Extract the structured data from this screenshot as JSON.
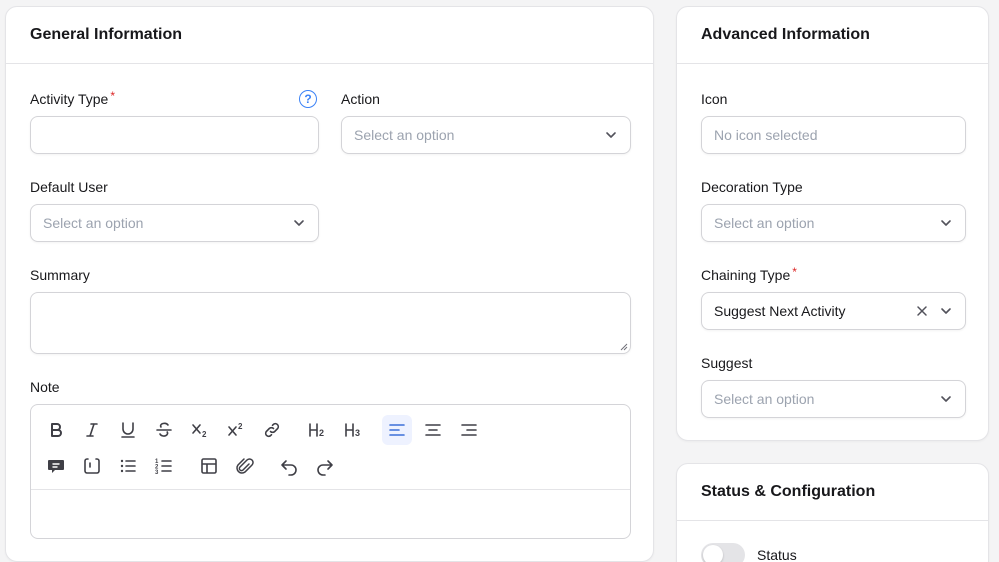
{
  "general": {
    "title": "General Information",
    "activity_type": {
      "label": "Activity Type",
      "required_mark": "*",
      "value": "",
      "help_icon": "question-circle-icon"
    },
    "action": {
      "label": "Action",
      "placeholder": "Select an option"
    },
    "default_user": {
      "label": "Default User",
      "placeholder": "Select an option"
    },
    "summary": {
      "label": "Summary",
      "value": ""
    },
    "note": {
      "label": "Note",
      "toolbar_row1": [
        {
          "name": "bold-icon",
          "glyph": "B"
        },
        {
          "name": "italic-icon",
          "glyph": "I"
        },
        {
          "name": "underline-icon",
          "glyph": "U"
        },
        {
          "name": "strikethrough-icon",
          "glyph": "S"
        },
        {
          "name": "subscript-icon",
          "glyph": "X₂"
        },
        {
          "name": "superscript-icon",
          "glyph": "X²"
        },
        {
          "name": "link-icon",
          "glyph": ""
        },
        {
          "name": "heading-2-icon",
          "glyph": "H₂"
        },
        {
          "name": "heading-3-icon",
          "glyph": "H₃"
        },
        {
          "name": "align-left-icon",
          "glyph": ""
        },
        {
          "name": "align-center-icon",
          "glyph": ""
        },
        {
          "name": "align-right-icon",
          "glyph": ""
        }
      ],
      "toolbar_row2": [
        {
          "name": "blockquote-icon",
          "glyph": ""
        },
        {
          "name": "code-block-icon",
          "glyph": ""
        },
        {
          "name": "bullet-list-icon",
          "glyph": ""
        },
        {
          "name": "ordered-list-icon",
          "glyph": ""
        },
        {
          "name": "table-icon",
          "glyph": ""
        },
        {
          "name": "attach-file-icon",
          "glyph": ""
        },
        {
          "name": "undo-icon",
          "glyph": ""
        },
        {
          "name": "redo-icon",
          "glyph": ""
        }
      ],
      "active_tool": "align-left-icon",
      "value": ""
    }
  },
  "advanced": {
    "title": "Advanced Information",
    "icon": {
      "label": "Icon",
      "placeholder": "No icon selected"
    },
    "decoration_type": {
      "label": "Decoration Type",
      "placeholder": "Select an option"
    },
    "chaining_type": {
      "label": "Chaining Type",
      "required_mark": "*",
      "value": "Suggest Next Activity"
    },
    "suggest": {
      "label": "Suggest",
      "placeholder": "Select an option"
    }
  },
  "status_config": {
    "title": "Status & Configuration",
    "status": {
      "label": "Status",
      "enabled": false
    }
  },
  "colors": {
    "background": "#f4f4f5",
    "border": "#e4e4e7",
    "required": "#dc2626",
    "accent": "#3b82f6",
    "active_tool_bg": "#eef2ff"
  }
}
